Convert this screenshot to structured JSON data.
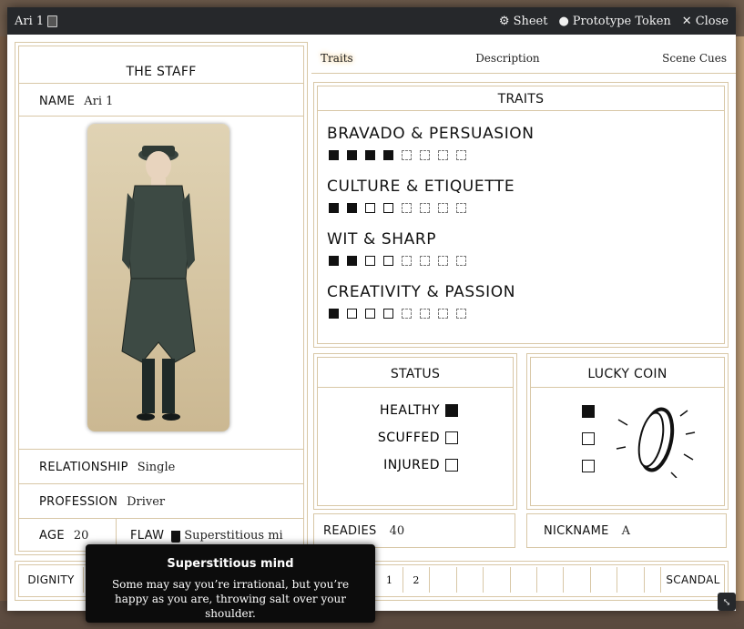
{
  "window": {
    "title": "Ari 1",
    "actions": [
      {
        "label": "Sheet",
        "icon": "gear-icon"
      },
      {
        "label": "Prototype Token",
        "icon": "user-circle-icon"
      },
      {
        "label": "Close",
        "icon": "close-icon"
      }
    ]
  },
  "staff": {
    "header": "THE STAFF",
    "name_label": "NAME",
    "name_value": "Ari 1",
    "relationship_label": "RELATIONSHIP",
    "relationship_value": "Single",
    "profession_label": "PROFESSION",
    "profession_value": "Driver",
    "age_label": "AGE",
    "age_value": "20",
    "flaw_label": "FLAW",
    "flaw_value": "Superstitious mi"
  },
  "tabs": [
    "Traits",
    "Description",
    "Scene Cues"
  ],
  "traits": {
    "header": "TRAITS",
    "items": [
      {
        "name": "BRAVADO & PERSUASION",
        "filled": 4,
        "solid_empty": 0
      },
      {
        "name": "CULTURE & ETIQUETTE",
        "filled": 2,
        "solid_empty": 2
      },
      {
        "name": "WIT & SHARP",
        "filled": 2,
        "solid_empty": 2
      },
      {
        "name": "CREATIVITY & PASSION",
        "filled": 1,
        "solid_empty": 3
      }
    ],
    "total_boxes": 8
  },
  "status": {
    "header": "STATUS",
    "rows": [
      {
        "label": "HEALTHY",
        "checked": true
      },
      {
        "label": "SCUFFED",
        "checked": false
      },
      {
        "label": "INJURED",
        "checked": false
      }
    ]
  },
  "lucky_coin": {
    "header": "LUCKY COIN",
    "checks": [
      true,
      false,
      false
    ]
  },
  "readies": {
    "label": "READIES",
    "value": "40"
  },
  "nickname": {
    "label": "NICKNAME",
    "value": "A"
  },
  "dignity": {
    "left_label": "DIGNITY",
    "right_label": "SCANDAL",
    "cells": [
      "1",
      "2",
      "",
      "",
      "",
      "",
      "",
      "",
      "",
      ""
    ]
  },
  "tooltip": {
    "title": "Superstitious mind",
    "body": "Some may say you’re irrational, but you’re happy as you are, throwing salt over your shoulder."
  },
  "colors": {
    "border": "#d8c7a6",
    "titlebar": "#26282b",
    "accent_glow": "#e6b14a"
  }
}
